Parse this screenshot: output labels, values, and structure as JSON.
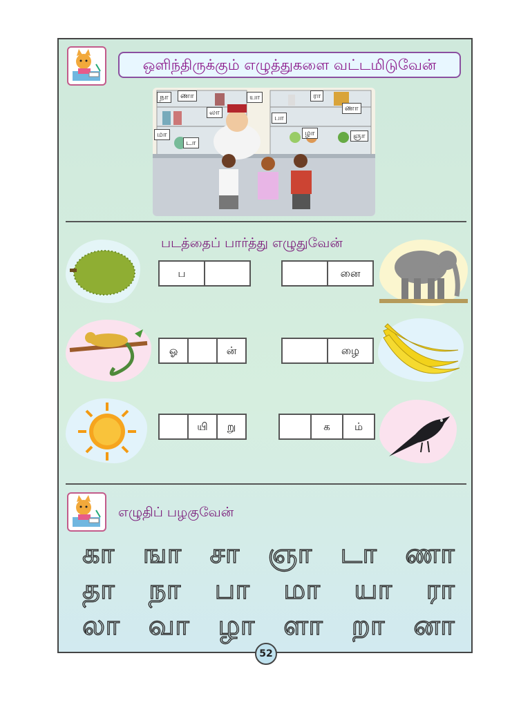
{
  "section1": {
    "title": "ஒளிந்திருக்கும் எழுத்துகளை வட்டமிடுவேன்",
    "hidden_letters": [
      "நா",
      "ணா",
      "யா",
      "ரா",
      "லா",
      "பா",
      "ணா",
      "மா",
      "டா",
      "ழா",
      "ஞா"
    ]
  },
  "section2": {
    "title": "படத்தைப் பார்த்து எழுதுவேன்",
    "items": [
      {
        "name": "jackfruit",
        "cells": [
          "ப",
          ""
        ]
      },
      {
        "name": "elephant",
        "cells": [
          "",
          "னை"
        ]
      },
      {
        "name": "chameleon",
        "cells": [
          "ஓ",
          "",
          "ன்"
        ]
      },
      {
        "name": "banana",
        "cells": [
          "",
          "ழை"
        ]
      },
      {
        "name": "sun",
        "cells": [
          "",
          "யி",
          "று"
        ]
      },
      {
        "name": "crow",
        "cells": [
          "",
          "க",
          "ம்"
        ]
      }
    ]
  },
  "section3": {
    "title": "எழுதிப் பழகுவேன்",
    "rows": [
      [
        "கா",
        "ஙா",
        "சா",
        "ஞா",
        "டா",
        "ணா"
      ],
      [
        "தா",
        "நா",
        "பா",
        "மா",
        "யா",
        "ரா"
      ],
      [
        "லா",
        "வா",
        "ழா",
        "ளா",
        "றா",
        "னா"
      ]
    ]
  },
  "page_number": "52",
  "colors": {
    "title": "#8b1a8b",
    "border": "#444444",
    "bg_top": "#cfe9dc",
    "bg_bottom": "#d2eaf0"
  }
}
